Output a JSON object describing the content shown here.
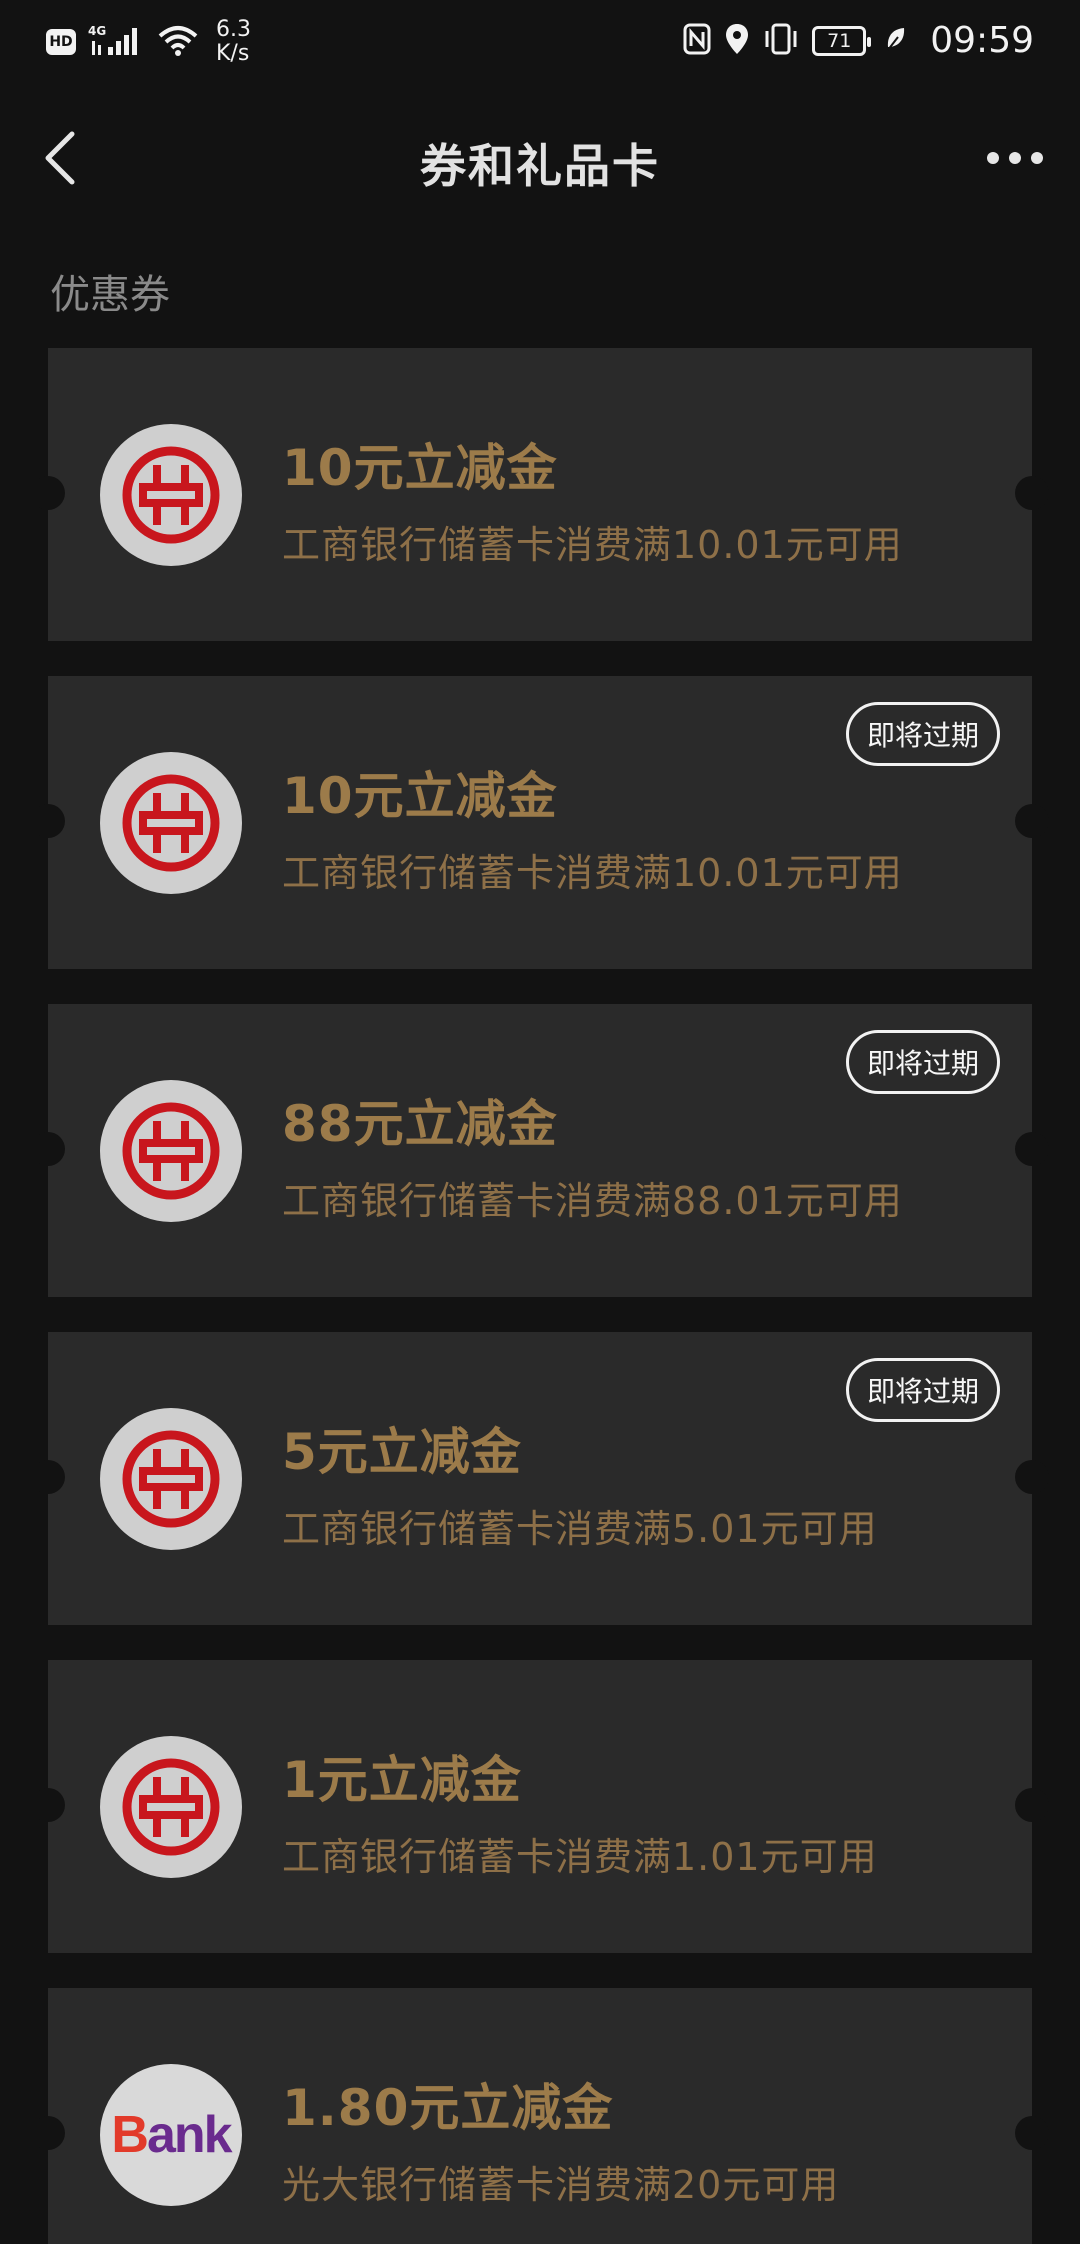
{
  "status_bar": {
    "hd": "HD",
    "net_speed_value": "6.3",
    "net_speed_unit": "K/s",
    "battery": "71",
    "time": "09:59"
  },
  "header": {
    "title": "券和礼品卡"
  },
  "section": {
    "title": "优惠券"
  },
  "coupons": [
    {
      "amount": "10元立减金",
      "desc": "工商银行储蓄卡消费满10.01元可用",
      "badge": "",
      "logo": "icbc-logo-icon"
    },
    {
      "amount": "10元立减金",
      "desc": "工商银行储蓄卡消费满10.01元可用",
      "badge": "即将过期",
      "logo": "icbc-logo-icon"
    },
    {
      "amount": "88元立减金",
      "desc": "工商银行储蓄卡消费满88.01元可用",
      "badge": "即将过期",
      "logo": "icbc-logo-icon"
    },
    {
      "amount": "5元立减金",
      "desc": "工商银行储蓄卡消费满5.01元可用",
      "badge": "即将过期",
      "logo": "icbc-logo-icon"
    },
    {
      "amount": "1元立减金",
      "desc": "工商银行储蓄卡消费满1.01元可用",
      "badge": "",
      "logo": "icbc-logo-icon"
    },
    {
      "amount": "1.80元立减金",
      "desc": "光大银行储蓄卡消费满20元可用",
      "badge": "",
      "logo": "bank-logo-icon",
      "logo_text_first": "B",
      "logo_text_rest": "ank"
    }
  ],
  "colors": {
    "background": "#121212",
    "card": "#2a2a2a",
    "gold_text": "#9c7b4a",
    "icbc_red": "#c8161d"
  }
}
